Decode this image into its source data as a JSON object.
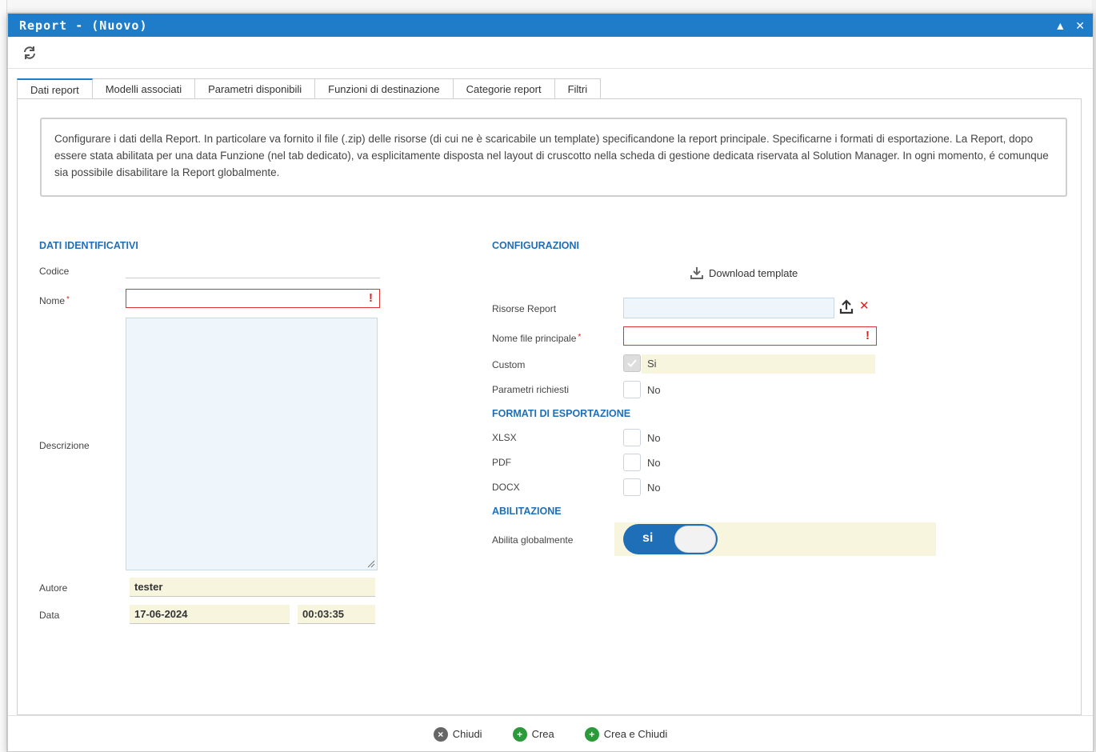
{
  "window": {
    "title": "Report - (Nuovo)"
  },
  "tabs": [
    {
      "label": "Dati report",
      "active": true
    },
    {
      "label": "Modelli associati"
    },
    {
      "label": "Parametri disponibili"
    },
    {
      "label": "Funzioni di destinazione"
    },
    {
      "label": "Categorie report"
    },
    {
      "label": "Filtri"
    }
  ],
  "info": "Configurare i dati della Report. In particolare va fornito il file (.zip) delle risorse (di cui ne è scaricabile un template) specificandone la report principale. Specificarne i formati di esportazione. La Report, dopo essere stata abilitata per una data Funzione (nel tab dedicato), va esplicitamente disposta nel layout di cruscotto nella scheda di gestione dedicata riservata al Solution Manager. In ogni momento, é comunque sia possibile disabilitare la Report globalmente.",
  "identificativi": {
    "title": "DATI IDENTIFICATIVI",
    "codice_label": "Codice",
    "nome_label": "Nome",
    "required_mark": "*",
    "error_mark": "!",
    "descrizione_label": "Descrizione",
    "autore_label": "Autore",
    "autore_value": "tester",
    "data_label": "Data",
    "data_value": "17-06-2024",
    "ora_value": "00:03:35"
  },
  "configurazioni": {
    "title": "CONFIGURAZIONI",
    "download_label": "Download template",
    "risorse_label": "Risorse Report",
    "nome_file_label": "Nome file principale",
    "custom_label": "Custom",
    "custom_value": "Si",
    "parametri_label": "Parametri richiesti",
    "parametri_value": "No"
  },
  "formati": {
    "title": "FORMATI DI ESPORTAZIONE",
    "xlsx_label": "XLSX",
    "xlsx_value": "No",
    "pdf_label": "PDF",
    "pdf_value": "No",
    "docx_label": "DOCX",
    "docx_value": "No"
  },
  "abilitazione": {
    "title": "ABILITAZIONE",
    "label": "Abilita globalmente",
    "toggle_value": "si"
  },
  "footer": {
    "chiudi": "Chiudi",
    "crea": "Crea",
    "crea_chiudi": "Crea e Chiudi"
  },
  "colors": {
    "accent": "#1f7cc9",
    "section": "#1f6fb8",
    "error": "#d33333",
    "readonly_bg": "#f8f5df"
  }
}
